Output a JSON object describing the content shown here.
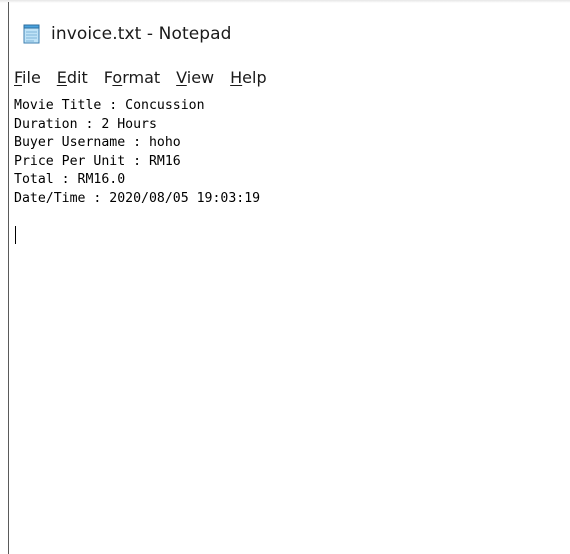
{
  "window": {
    "title": "invoice.txt - Notepad"
  },
  "menu": {
    "file": {
      "accel": "F",
      "rest": "ile"
    },
    "edit": {
      "accel": "E",
      "rest": "dit"
    },
    "format": {
      "pre": "F",
      "accel": "o",
      "rest": "rmat"
    },
    "view": {
      "accel": "V",
      "rest": "iew"
    },
    "help": {
      "accel": "H",
      "rest": "elp"
    }
  },
  "document": {
    "lines": [
      "Movie Title : Concussion",
      "Duration : 2 Hours",
      "Buyer Username : hoho",
      "Price Per Unit : RM16",
      "Total : RM16.0",
      "Date/Time : 2020/08/05 19:03:19"
    ]
  },
  "icons": {
    "app": "notepad-icon"
  },
  "colors": {
    "background": "#ffffff",
    "text": "#000000",
    "border": "#5a5a5a"
  }
}
